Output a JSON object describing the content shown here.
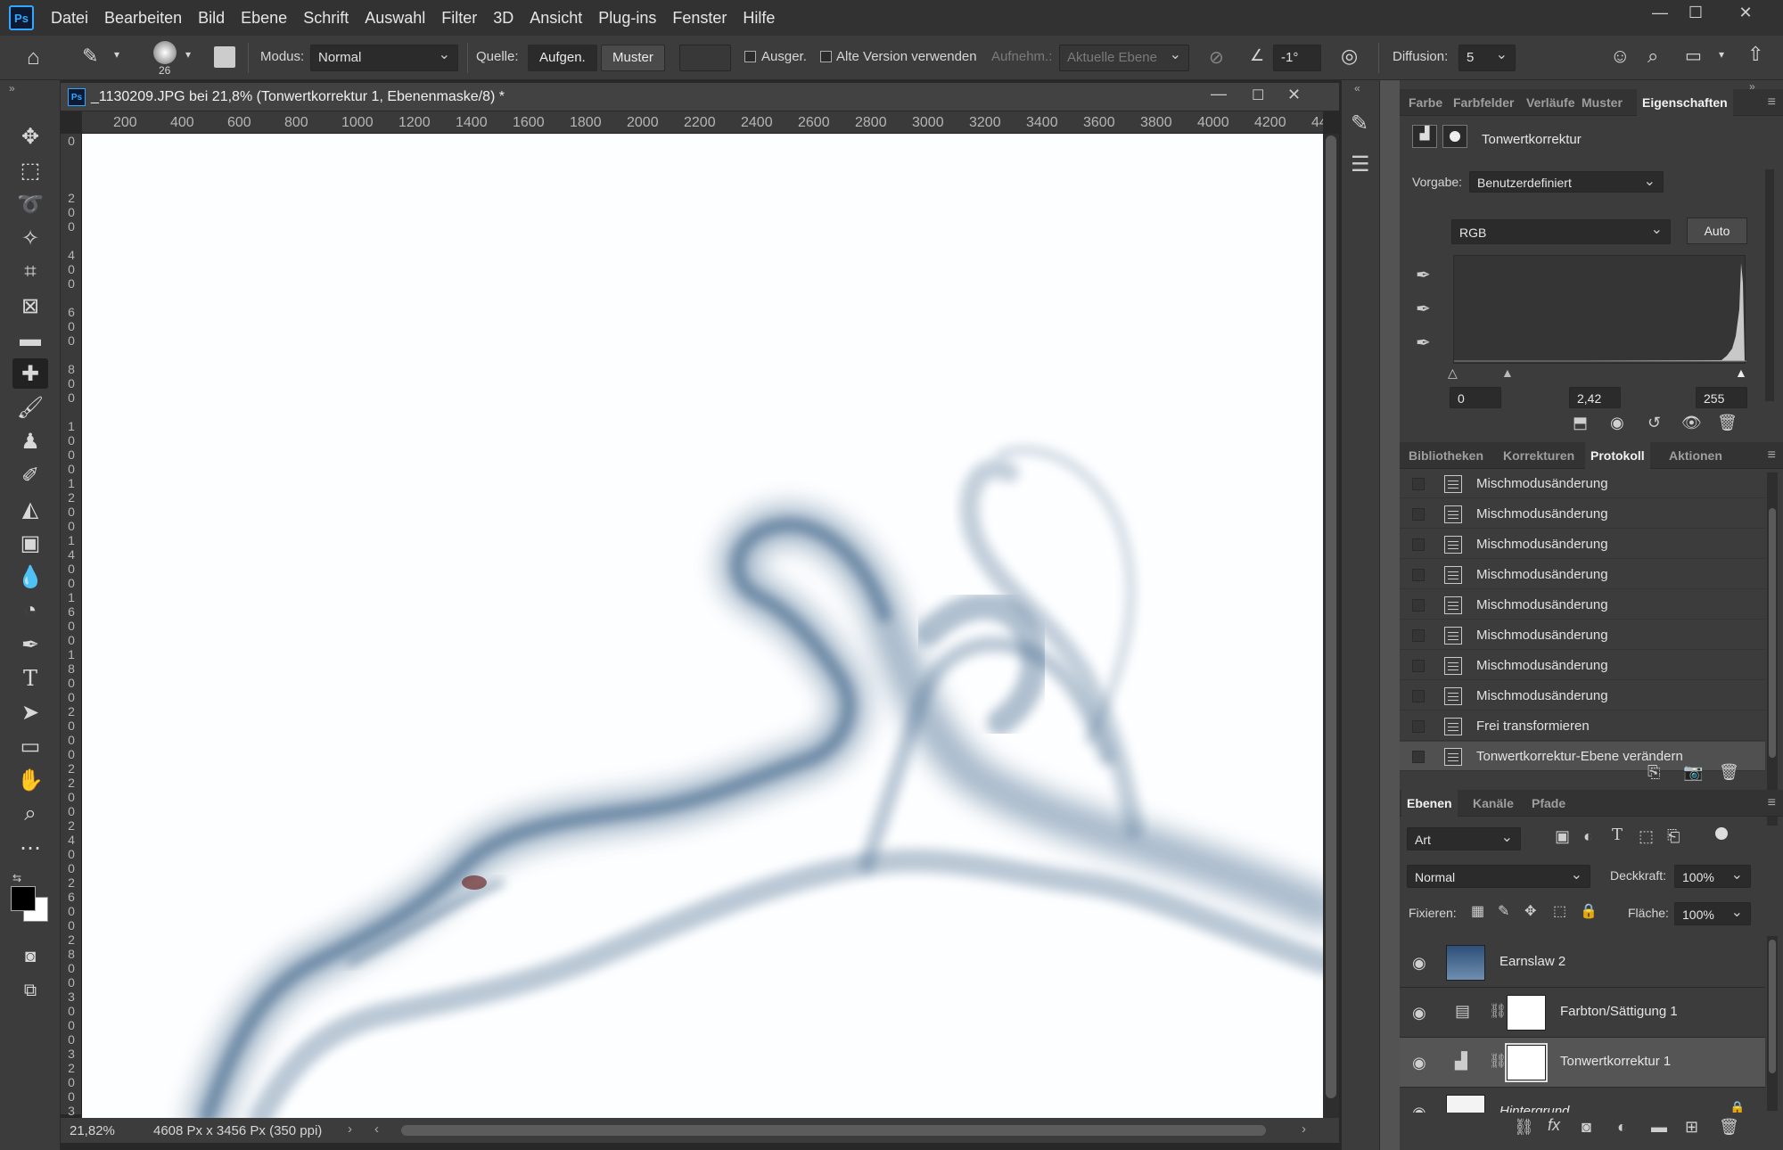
{
  "menubar": {
    "logo": "Ps",
    "items": [
      "Datei",
      "Bearbeiten",
      "Bild",
      "Ebene",
      "Schrift",
      "Auswahl",
      "Filter",
      "3D",
      "Ansicht",
      "Plug-ins",
      "Fenster",
      "Hilfe"
    ]
  },
  "options": {
    "brush_size": "26",
    "modus_label": "Modus:",
    "modus_value": "Normal",
    "quelle_label": "Quelle:",
    "aufgen": "Aufgen.",
    "muster": "Muster",
    "ausger": "Ausger.",
    "alte_version": "Alte Version verwenden",
    "aufnehm": "Aufnehm.:",
    "aktuelle_ebene": "Aktuelle Ebene",
    "angle": "-1°",
    "diffusion_label": "Diffusion:",
    "diffusion_value": "5"
  },
  "document": {
    "title": "_1130209.JPG bei 21,8% (Tonwertkorrektur 1, Ebenenmaske/8) *",
    "icon": "Ps",
    "ruler_top": [
      "200",
      "400",
      "600",
      "800",
      "1000",
      "1200",
      "1400",
      "1600",
      "1800",
      "2000",
      "2200",
      "2400",
      "2600",
      "2800",
      "3000",
      "3200",
      "3400",
      "3600",
      "3800",
      "4000",
      "4200",
      "44"
    ],
    "ruler_left": [
      "0",
      "2 0 0",
      "4 0 0",
      "6 0 0",
      "8 0 0",
      "1 0 0 0",
      "1 2 0 0",
      "1 4 0 0",
      "1 6 0 0",
      "1 8 0 0",
      "2 0 0 0",
      "2 2 0 0",
      "2 4 0 0",
      "2 6 0 0",
      "2 8 0 0",
      "3 0 0 0",
      "3 2 0 0",
      "3"
    ],
    "zoom": "21,82%",
    "size": "4608 Px x 3456 Px (350 ppi)"
  },
  "props_panel": {
    "tabs": [
      "Farbe",
      "Farbfelder",
      "Verläufe",
      "Muster",
      "Eigenschaften"
    ],
    "adjust_name": "Tonwertkorrektur",
    "vorgabe_label": "Vorgabe:",
    "vorgabe_value": "Benutzerdefiniert",
    "channel": "RGB",
    "auto": "Auto",
    "input_black": "0",
    "input_gamma": "2,42",
    "input_white": "255"
  },
  "history_panel": {
    "tabs": [
      "Bibliotheken",
      "Korrekturen",
      "Protokoll",
      "Aktionen"
    ],
    "items": [
      "Mischmodusänderung",
      "Mischmodusänderung",
      "Mischmodusänderung",
      "Mischmodusänderung",
      "Mischmodusänderung",
      "Mischmodusänderung",
      "Mischmodusänderung",
      "Mischmodusänderung",
      "Frei transformieren",
      "Tonwertkorrektur-Ebene verändern"
    ]
  },
  "layers_panel": {
    "tabs": [
      "Ebenen",
      "Kanäle",
      "Pfade"
    ],
    "filter": "Art",
    "blend": "Normal",
    "deckkraft_label": "Deckkraft:",
    "deckkraft": "100%",
    "fixieren": "Fixieren:",
    "flaeche_label": "Fläche:",
    "flaeche": "100%",
    "layers": [
      "Earnslaw 2",
      "Farbton/Sättigung 1",
      "Tonwertkorrektur 1",
      "Hintergrund"
    ]
  },
  "colors": {
    "smoke": "#3e6488",
    "accent": "#31a8ff"
  }
}
